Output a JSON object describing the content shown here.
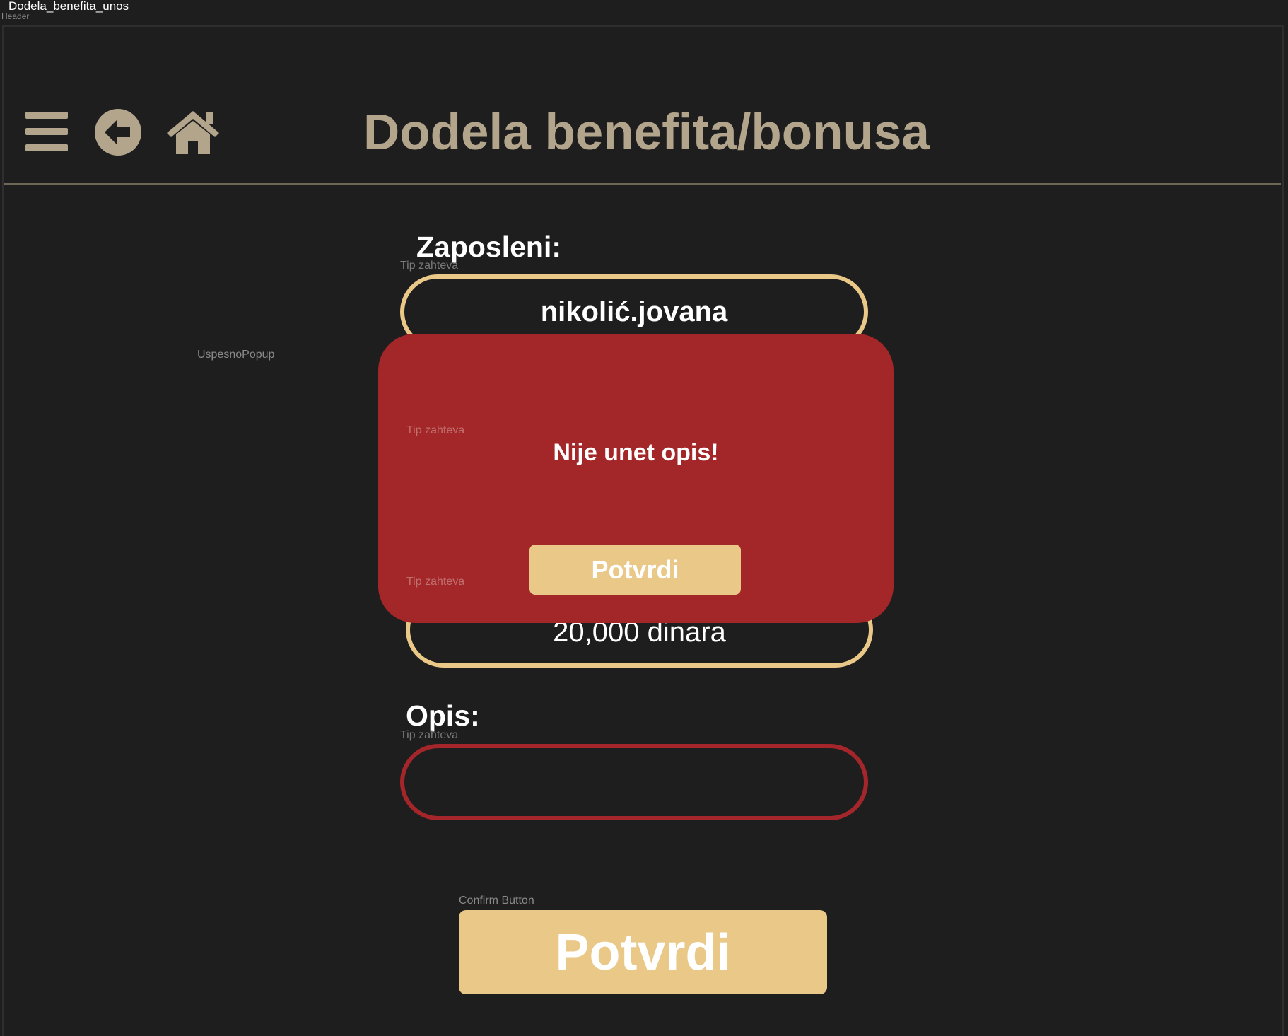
{
  "frame": {
    "title": "Dodela_benefita_unos",
    "sublabel": "Header"
  },
  "header": {
    "title": "Dodela benefita/bonusa",
    "icons": [
      "menu-icon",
      "back-icon",
      "home-icon"
    ]
  },
  "form": {
    "employee_label": "Zaposleni:",
    "employee_value": "nikolić.jovana",
    "amount_value": "20,000 dinara",
    "description_label": "Opis:",
    "description_value": "",
    "field_caption": "Tip zahteva",
    "confirm_caption": "Confirm Button",
    "confirm_label": "Potvrdi"
  },
  "popup": {
    "caption": "UspesnoPopup",
    "message": "Nije unet opis!",
    "button_label": "Potvrdi",
    "inner_caption_1": "Tip zahteva",
    "inner_caption_2": "Tip zahteva"
  },
  "colors": {
    "background": "#1e1e1e",
    "accent": "#eac887",
    "muted": "#b3a48c",
    "error": "#a32628"
  }
}
